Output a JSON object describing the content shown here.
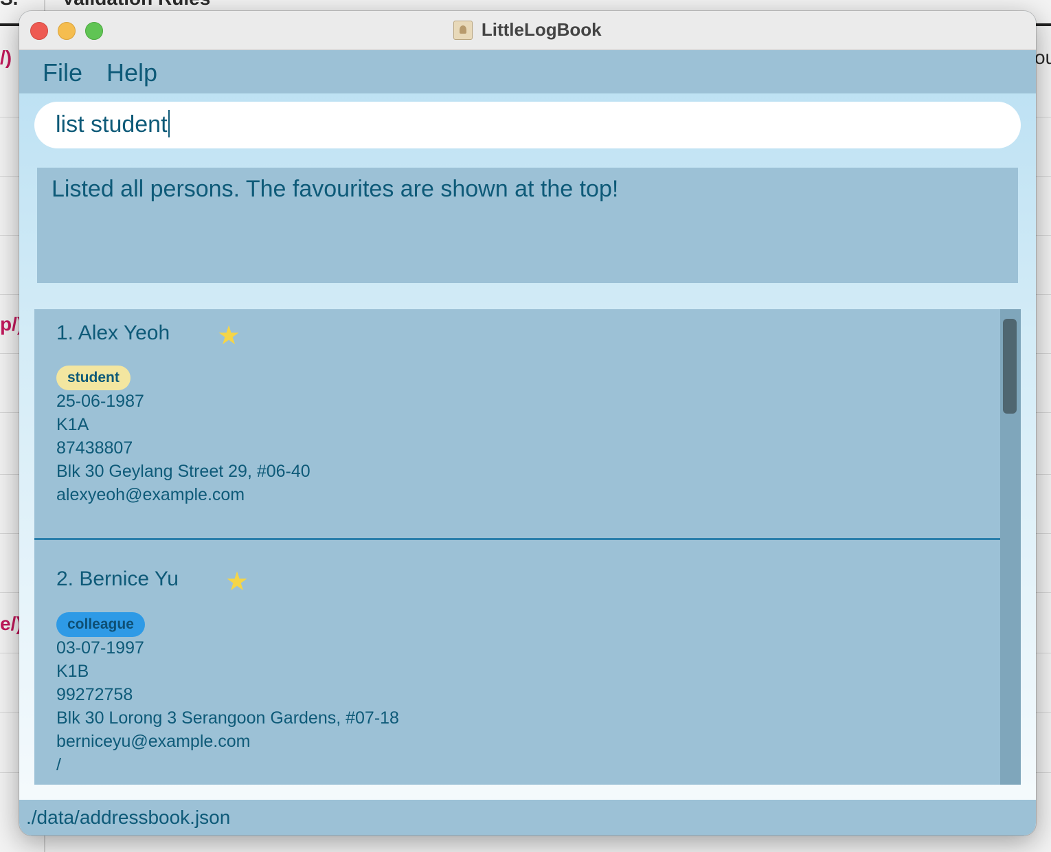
{
  "background": {
    "heading_fragment": "Validation Rules",
    "left_fragments": [
      "/)",
      "p/)",
      "e/)"
    ],
    "left_top_fragment": "S.",
    "right_fragment": "ou"
  },
  "window": {
    "title": "LittleLogBook",
    "app_icon": "address-book-icon"
  },
  "menu": {
    "file_label": "File",
    "help_label": "Help"
  },
  "command": {
    "value": "list student"
  },
  "result": {
    "message": "Listed all persons. The favourites are shown at the top!"
  },
  "persons": [
    {
      "name": "1. Alex Yeoh",
      "favourite_icon": "star-icon",
      "tag": "student",
      "tag_color": "#f3e6a0",
      "birthday": "25-06-1987",
      "class": "K1A",
      "phone": "87438807",
      "address": "Blk 30 Geylang Street 29, #06-40",
      "email": "alexyeoh@example.com"
    },
    {
      "name": "2. Bernice Yu",
      "favourite_icon": "star-icon",
      "tag": "colleague",
      "tag_color": "#2e9ae6",
      "birthday": "03-07-1997",
      "class": "K1B",
      "phone": "99272758",
      "address": "Blk 30 Lorong 3 Serangoon Gardens, #07-18",
      "email": "berniceyu@example.com",
      "extra": "/"
    }
  ],
  "status": {
    "file_path": "./data/addressbook.json"
  },
  "colors": {
    "panel": "#9cc1d6",
    "text": "#0e5a78",
    "star": "#f5d547"
  }
}
